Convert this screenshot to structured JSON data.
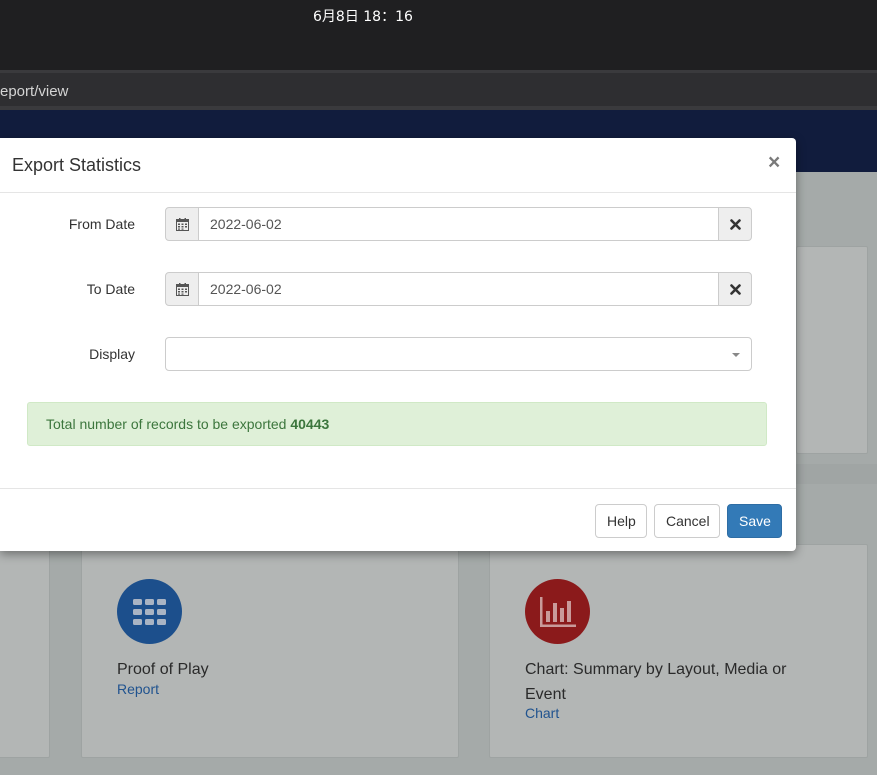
{
  "system": {
    "clock": "6月8日 18：16"
  },
  "browser": {
    "url": "eport/view"
  },
  "modal": {
    "title": "Export Statistics",
    "close_label": "×",
    "from_label": "From Date",
    "from_value": "2022-06-02",
    "to_label": "To Date",
    "to_value": "2022-06-02",
    "display_label": "Display",
    "display_value": "",
    "alert_text": "Total number of records to be exported ",
    "alert_count": "40443",
    "buttons": {
      "help": "Help",
      "cancel": "Cancel",
      "save": "Save"
    }
  },
  "cards": [
    {
      "title": "Proof of Play",
      "link": "Report",
      "icon": "grid-icon",
      "color": "#1c4f8c"
    },
    {
      "title": "Chart: Summary by Layout, Media or Event",
      "link": "Chart",
      "icon": "bar-chart-icon",
      "color": "#8b1a1b"
    }
  ],
  "colors": {
    "primary": "#337ab7",
    "success_bg": "#dff0d8",
    "success_text": "#3c763d",
    "header_navy": "#111c3d"
  }
}
